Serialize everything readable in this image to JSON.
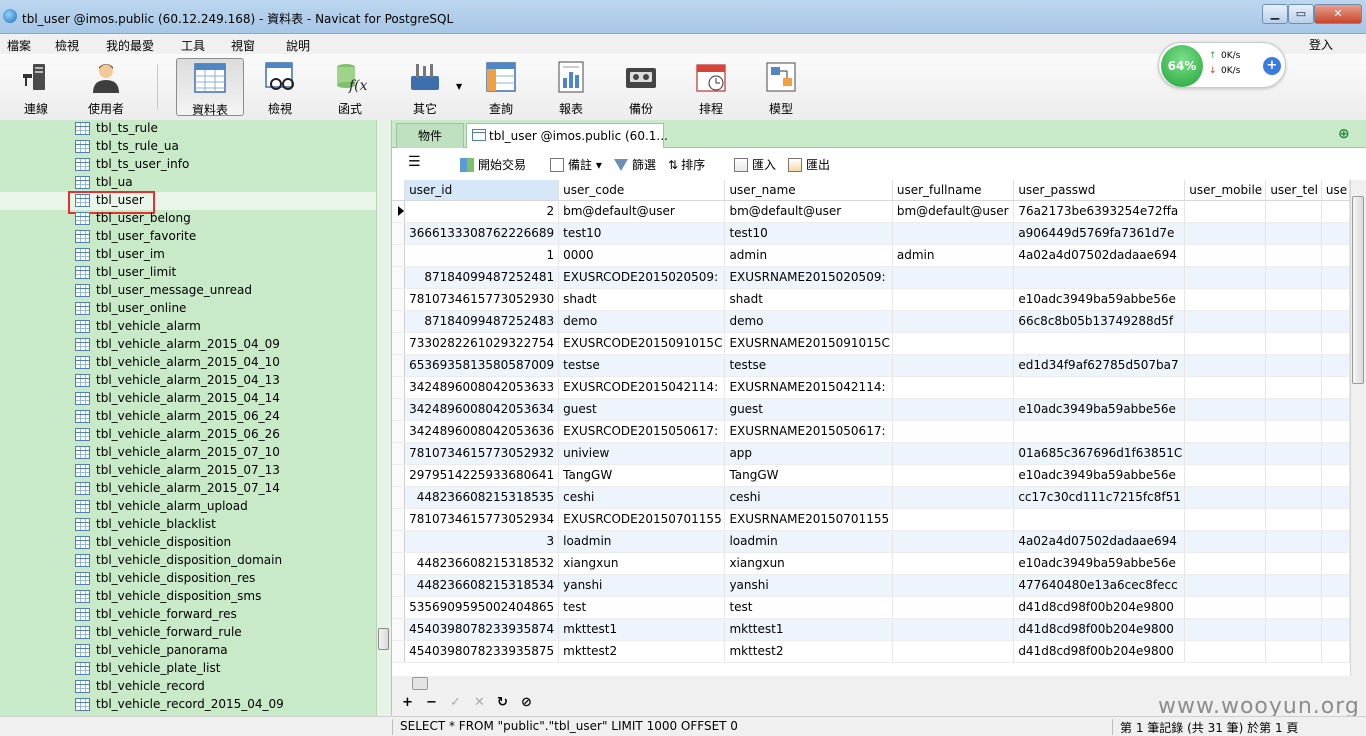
{
  "window": {
    "title": "tbl_user @imos.public (60.12.249.168) - 資料表 - Navicat for PostgreSQL",
    "minimize": "▁",
    "maximize": "▭",
    "close": "✕"
  },
  "menu": [
    "檔案",
    "檢視",
    "我的最愛",
    "工具",
    "視窗",
    "說明"
  ],
  "login_label": "登入",
  "toolbar": [
    {
      "label": "連線",
      "icon": "connection-icon"
    },
    {
      "label": "使用者",
      "icon": "user-icon"
    },
    {
      "label": "資料表",
      "icon": "table-icon"
    },
    {
      "label": "檢視",
      "icon": "view-icon"
    },
    {
      "label": "函式",
      "icon": "function-icon"
    },
    {
      "label": "其它",
      "icon": "tools-icon"
    },
    {
      "label": "查詢",
      "icon": "query-icon"
    },
    {
      "label": "報表",
      "icon": "report-icon"
    },
    {
      "label": "備份",
      "icon": "backup-icon"
    },
    {
      "label": "排程",
      "icon": "schedule-icon"
    },
    {
      "label": "模型",
      "icon": "model-icon"
    }
  ],
  "net_meter": {
    "percent": "64%",
    "up": "0K/s",
    "down": "0K/s"
  },
  "sidebar": {
    "items": [
      "tbl_ts_rule",
      "tbl_ts_rule_ua",
      "tbl_ts_user_info",
      "tbl_ua",
      "tbl_user",
      "tbl_user_belong",
      "tbl_user_favorite",
      "tbl_user_im",
      "tbl_user_limit",
      "tbl_user_message_unread",
      "tbl_user_online",
      "tbl_vehicle_alarm",
      "tbl_vehicle_alarm_2015_04_09",
      "tbl_vehicle_alarm_2015_04_10",
      "tbl_vehicle_alarm_2015_04_13",
      "tbl_vehicle_alarm_2015_04_14",
      "tbl_vehicle_alarm_2015_06_24",
      "tbl_vehicle_alarm_2015_06_26",
      "tbl_vehicle_alarm_2015_07_10",
      "tbl_vehicle_alarm_2015_07_13",
      "tbl_vehicle_alarm_2015_07_14",
      "tbl_vehicle_alarm_upload",
      "tbl_vehicle_blacklist",
      "tbl_vehicle_disposition",
      "tbl_vehicle_disposition_domain",
      "tbl_vehicle_disposition_res",
      "tbl_vehicle_disposition_sms",
      "tbl_vehicle_forward_res",
      "tbl_vehicle_forward_rule",
      "tbl_vehicle_panorama",
      "tbl_vehicle_plate_list",
      "tbl_vehicle_record",
      "tbl_vehicle_record_2015_04_09"
    ],
    "selected": "tbl_user"
  },
  "tabs": {
    "objects": "物件",
    "table": "tbl_user @imos.public (60.1..."
  },
  "data_toolbar": {
    "menu": "☰",
    "begin_transaction": "開始交易",
    "memo": "備註",
    "filter": "篩選",
    "sort": "排序",
    "import": "匯入",
    "export": "匯出"
  },
  "grid": {
    "columns": [
      "user_id",
      "user_code",
      "user_name",
      "user_fullname",
      "user_passwd",
      "user_mobile",
      "user_tel",
      "use"
    ],
    "rows": [
      [
        "2",
        "bm@default@user",
        "bm@default@user",
        "bm@default@user",
        "76a2173be6393254e72ffa",
        "",
        "",
        ""
      ],
      [
        "3666133308762226689",
        "test10",
        "test10",
        "",
        "a906449d5769fa7361d7e",
        "",
        "",
        ""
      ],
      [
        "1",
        "0000",
        "admin",
        "admin",
        "4a02a4d07502dadaae694",
        "",
        "",
        ""
      ],
      [
        "87184099487252481",
        "EXUSRCODE2015020509:",
        "EXUSRNAME2015020509:",
        "",
        "",
        "",
        "",
        ""
      ],
      [
        "7810734615773052930",
        "shadt",
        "shadt",
        "",
        "e10adc3949ba59abbe56e",
        "",
        "",
        ""
      ],
      [
        "87184099487252483",
        "demo",
        "demo",
        "",
        "66c8c8b05b13749288d5f",
        "",
        "",
        ""
      ],
      [
        "7330282261029322754",
        "EXUSRCODE2015091015C",
        "EXUSRNAME2015091015C",
        "",
        "",
        "",
        "",
        ""
      ],
      [
        "6536935813580587009",
        "testse",
        "testse",
        "",
        "ed1d34f9af62785d507ba7",
        "",
        "",
        ""
      ],
      [
        "3424896008042053633",
        "EXUSRCODE2015042114:",
        "EXUSRNAME2015042114:",
        "",
        "",
        "",
        "",
        ""
      ],
      [
        "3424896008042053634",
        "guest",
        "guest",
        "",
        "e10adc3949ba59abbe56e",
        "",
        "",
        ""
      ],
      [
        "3424896008042053636",
        "EXUSRCODE2015050617:",
        "EXUSRNAME2015050617:",
        "",
        "",
        "",
        "",
        ""
      ],
      [
        "7810734615773052932",
        "uniview",
        "app",
        "",
        "01a685c367696d1f63851C",
        "",
        "",
        ""
      ],
      [
        "2979514225933680641",
        "TangGW",
        "TangGW",
        "",
        "e10adc3949ba59abbe56e",
        "",
        "",
        ""
      ],
      [
        "448236608215318535",
        "ceshi",
        "ceshi",
        "",
        "cc17c30cd111c7215fc8f51",
        "",
        "",
        ""
      ],
      [
        "7810734615773052934",
        "EXUSRCODE20150701155",
        "EXUSRNAME20150701155",
        "",
        "",
        "",
        "",
        ""
      ],
      [
        "3",
        "loadmin",
        "loadmin",
        "",
        "4a02a4d07502dadaae694",
        "",
        "",
        ""
      ],
      [
        "448236608215318532",
        "xiangxun",
        "xiangxun",
        "",
        "e10adc3949ba59abbe56e",
        "",
        "",
        ""
      ],
      [
        "448236608215318534",
        "yanshi",
        "yanshi",
        "",
        "477640480e13a6cec8fecc",
        "",
        "",
        ""
      ],
      [
        "5356909595002404865",
        "test",
        "test",
        "",
        "d41d8cd98f00b204e9800",
        "",
        "",
        ""
      ],
      [
        "4540398078233935874",
        "mkttest1",
        "mkttest1",
        "",
        "d41d8cd98f00b204e9800",
        "",
        "",
        ""
      ],
      [
        "4540398078233935875",
        "mkttest2",
        "mkttest2",
        "",
        "d41d8cd98f00b204e9800",
        "",
        "",
        ""
      ]
    ]
  },
  "nav": {
    "add": "+",
    "delete": "−",
    "apply": "✓",
    "cancel": "✕",
    "refresh": "↻",
    "stop": "⊘"
  },
  "status": {
    "sql": "SELECT * FROM \"public\".\"tbl_user\" LIMIT 1000 OFFSET 0",
    "records": "第 1 筆記錄 (共 31 筆) 於第 1 頁"
  },
  "watermark": "www.wooyun.org"
}
